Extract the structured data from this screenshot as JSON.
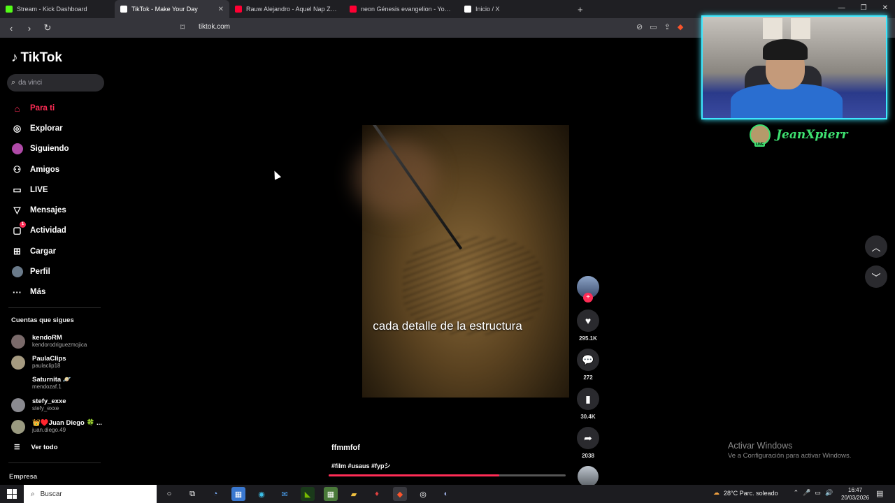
{
  "browser": {
    "tabs": [
      {
        "title": "Stream - Kick Dashboard",
        "color": "#53fc18",
        "active": false
      },
      {
        "title": "TikTok - Make Your Day",
        "color": "#ffffff",
        "active": true
      },
      {
        "title": "Rauw Alejandro - Aquel Nap ZzZz (A",
        "color": "#ff0033",
        "active": false
      },
      {
        "title": "neon Génesis evangelion - YouTube",
        "color": "#ff0033",
        "active": false
      },
      {
        "title": "Inicio / X",
        "color": "#ffffff",
        "active": false
      }
    ],
    "url": "tiktok.com"
  },
  "sidebar": {
    "logo": "TikTok",
    "search_value": "da vinci",
    "nav": [
      {
        "label": "Para ti",
        "icon": "home-icon",
        "glyph": "⌂",
        "active": true
      },
      {
        "label": "Explorar",
        "icon": "compass-icon",
        "glyph": "◎",
        "active": false
      },
      {
        "label": "Siguiendo",
        "icon": "following-avatar-icon",
        "glyph": "●",
        "active": false
      },
      {
        "label": "Amigos",
        "icon": "friends-icon",
        "glyph": "👥",
        "active": false
      },
      {
        "label": "LIVE",
        "icon": "live-tv-icon",
        "glyph": "▭",
        "active": false
      },
      {
        "label": "Mensajes",
        "icon": "messages-icon",
        "glyph": "▽",
        "active": false
      },
      {
        "label": "Actividad",
        "icon": "activity-icon",
        "glyph": "▢",
        "active": false,
        "badge": "1"
      },
      {
        "label": "Cargar",
        "icon": "upload-icon",
        "glyph": "⊞",
        "active": false
      },
      {
        "label": "Perfil",
        "icon": "profile-avatar-icon",
        "glyph": "●",
        "active": false
      },
      {
        "label": "Más",
        "icon": "more-icon",
        "glyph": "···",
        "active": false
      }
    ],
    "following_title": "Cuentas que sigues",
    "accounts": [
      {
        "name": "kendoRM",
        "handle": "kendorodriguezmojica"
      },
      {
        "name": "PaulaClips",
        "handle": "paulaclip18"
      },
      {
        "name": "Saturnita 🪐",
        "handle": "mendozaf.1"
      },
      {
        "name": "stefy_exxe",
        "handle": "stefy_exxe"
      },
      {
        "name": "👑♥️Juan Diego 🍀 ...",
        "handle": "juan.diego.49"
      }
    ],
    "see_all": "Ver todo",
    "footer": "Empresa"
  },
  "video": {
    "caption": "cada detalle de la estructura",
    "username": "ffmmfof",
    "tags": "#film #usaus #fypシ",
    "progress": 0.72
  },
  "actions": {
    "likes": "295.1K",
    "comments": "272",
    "saves": "30.4K",
    "shares": "2038"
  },
  "overlay": {
    "streamer_name": "JeanXpierr",
    "live_badge": "LIVE"
  },
  "windows_watermark": {
    "line1": "Activar Windows",
    "line2": "Ve a Configuración para activar Windows."
  },
  "taskbar": {
    "search_placeholder": "Buscar",
    "weather": "28°C  Parc. soleado",
    "time": "16:47",
    "date": "20/03/2026"
  }
}
